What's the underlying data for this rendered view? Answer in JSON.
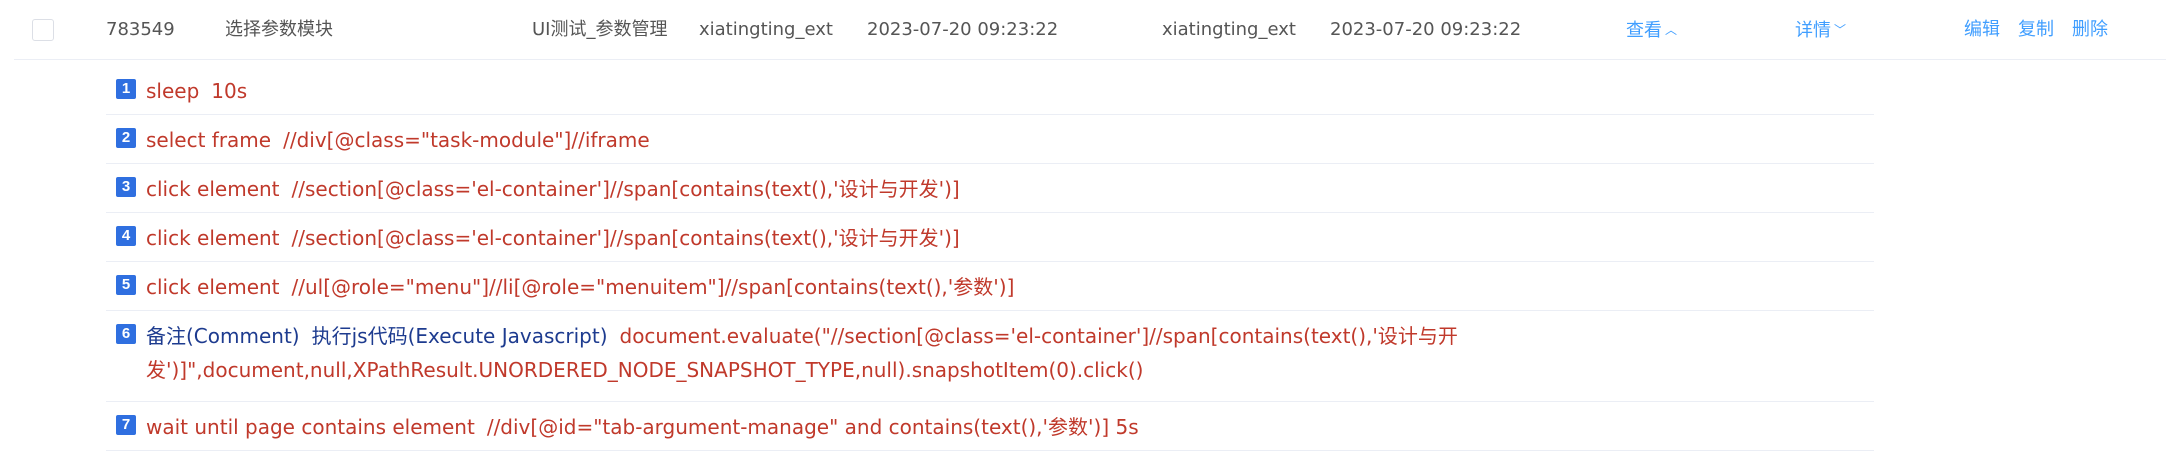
{
  "row": {
    "id": "783549",
    "name": "选择参数模块",
    "module": "UI测试_参数管理",
    "creator": "xiatingting_ext",
    "created_at": "2023-07-20 09:23:22",
    "updater": "xiatingting_ext",
    "updated_at": "2023-07-20 09:23:22",
    "view_label": "查看",
    "detail_label": "详情",
    "edit_label": "编辑",
    "copy_label": "复制",
    "delete_label": "删除"
  },
  "steps": [
    {
      "num": "1",
      "keyword": "sleep",
      "keyword2": "",
      "args": "10s",
      "cont": ""
    },
    {
      "num": "2",
      "keyword": "select frame",
      "keyword2": "",
      "args": "//div[@class=\"task-module\"]//iframe",
      "cont": ""
    },
    {
      "num": "3",
      "keyword": "click element",
      "keyword2": "",
      "args": "//section[@class='el-container']//span[contains(text(),'设计与开发')]",
      "cont": ""
    },
    {
      "num": "4",
      "keyword": "click element",
      "keyword2": "",
      "args": "//section[@class='el-container']//span[contains(text(),'设计与开发')]",
      "cont": ""
    },
    {
      "num": "5",
      "keyword": "click element",
      "keyword2": "",
      "args": "//ul[@role=\"menu\"]//li[@role=\"menuitem\"]//span[contains(text(),'参数')]",
      "cont": ""
    },
    {
      "num": "6",
      "keyword": "备注(Comment)",
      "keyword2": "执行js代码(Execute Javascript)",
      "args": "document.evaluate(\"//section[@class='el-container']//span[contains(text(),'设计与开",
      "cont": "发')]\",document,null,XPathResult.UNORDERED_NODE_SNAPSHOT_TYPE,null).snapshotItem(0).click()"
    },
    {
      "num": "7",
      "keyword": "wait until page contains element",
      "keyword2": "",
      "args": "//div[@id=\"tab-argument-manage\" and contains(text(),'参数')]   5s",
      "cont": ""
    }
  ],
  "colors": {
    "link": "#409eff",
    "keyword": "#c0392b",
    "badge": "#2f6fe0"
  }
}
